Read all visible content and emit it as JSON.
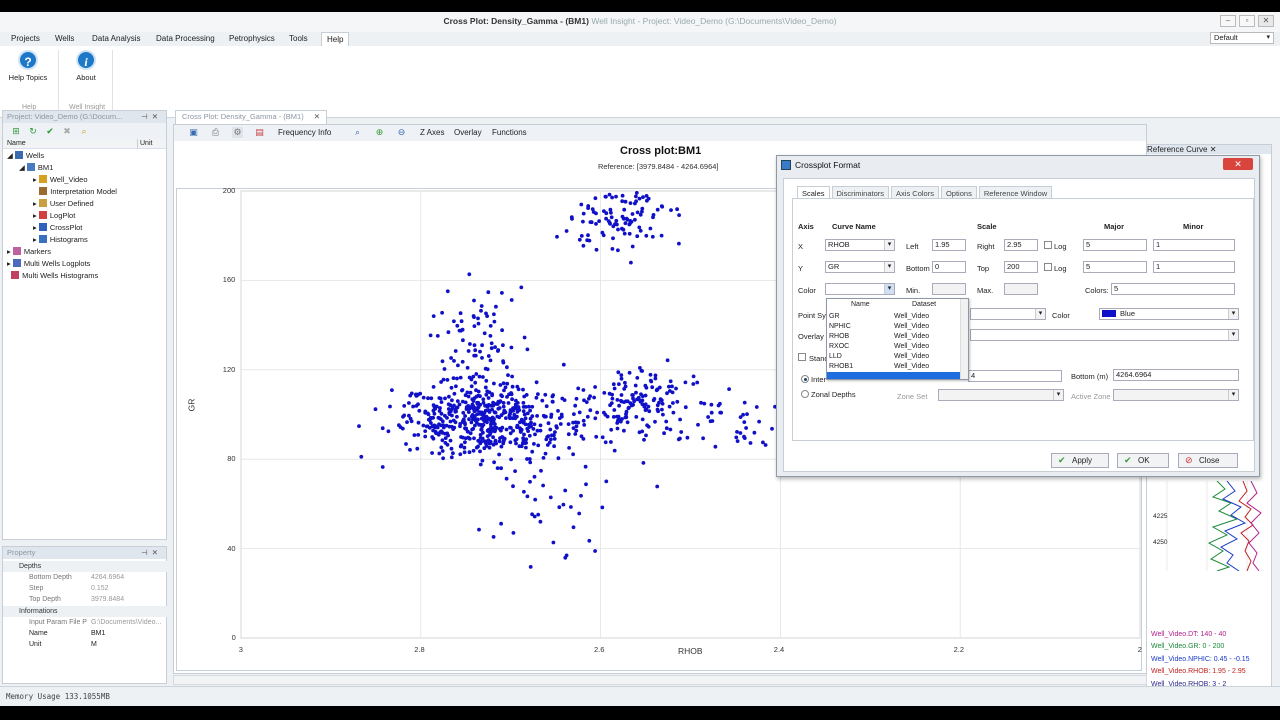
{
  "window": {
    "title_main": "Cross Plot: Density_Gamma - (BM1)",
    "title_sub": "Well Insight - Project: Video_Demo (G:\\Documents\\Video_Demo)",
    "controls": [
      "–",
      "▫",
      "✕"
    ]
  },
  "menu": [
    "Projects",
    "Wells",
    "Data Analysis",
    "Data Processing",
    "Petrophysics",
    "Tools",
    "Help"
  ],
  "active_menu": "Help",
  "layout_select": "Default",
  "ribbon": {
    "help_topics": "Help Topics",
    "about": "About",
    "group_help": "Help",
    "group_wellinsight": "Well Insight"
  },
  "project_panel": {
    "title": "Project: Video_Demo (G:\\Docum...",
    "col_name": "Name",
    "col_unit": "Unit",
    "tree": [
      {
        "label": "Wells",
        "level": 0
      },
      {
        "label": "BM1",
        "level": 1
      },
      {
        "label": "Well_Video",
        "level": 2
      },
      {
        "label": "Interpretation Model",
        "level": 2
      },
      {
        "label": "User Defined",
        "level": 2
      },
      {
        "label": "LogPlot",
        "level": 2
      },
      {
        "label": "CrossPlot",
        "level": 2
      },
      {
        "label": "Histograms",
        "level": 2
      },
      {
        "label": "Markers",
        "level": 0
      },
      {
        "label": "Multi Wells Logplots",
        "level": 0
      },
      {
        "label": "Multi Wells Histograms",
        "level": 0
      }
    ]
  },
  "property_panel": {
    "title": "Property",
    "rows": [
      {
        "k": "Depths",
        "v": "",
        "cat": true
      },
      {
        "k": "Bottom Depth",
        "v": "4264.6964"
      },
      {
        "k": "Step",
        "v": "0.152"
      },
      {
        "k": "Top Depth",
        "v": "3979.8484"
      },
      {
        "k": "Informations",
        "v": "",
        "cat": true
      },
      {
        "k": "Input Param File P",
        "v": "G:\\Documents\\Video..."
      },
      {
        "k": "Name",
        "v": "BM1",
        "dark": true
      },
      {
        "k": "Unit",
        "v": "M",
        "dark": true
      }
    ]
  },
  "doc_tab": "Cross Plot: Density_Gamma - (BM1)",
  "plot_toolbar": {
    "frequency_info": "Frequency Info",
    "z_axes": "Z Axes",
    "overlay": "Overlay",
    "functions": "Functions"
  },
  "chart_data": {
    "type": "scatter",
    "title": "Cross plot:BM1",
    "subtitle": "Reference: [3979.8484 - 4264.6964]",
    "xlabel": "RHOB",
    "ylabel": "GR",
    "xlim": [
      3,
      2
    ],
    "ylim": [
      0,
      200
    ],
    "x_ticks": [
      "3",
      "2.8",
      "2.6",
      "2.4",
      "2.2",
      "2"
    ],
    "y_ticks": [
      "200",
      "160",
      "120",
      "80",
      "40",
      "0"
    ],
    "point_color": "#1010c8",
    "grid": true,
    "clusters": [
      {
        "cx": 2.73,
        "cy": 97,
        "sx": 0.05,
        "sy": 8,
        "n": 520
      },
      {
        "cx": 2.56,
        "cy": 104,
        "sx": 0.04,
        "sy": 9,
        "n": 160
      },
      {
        "cx": 2.44,
        "cy": 97,
        "sx": 0.03,
        "sy": 8,
        "n": 40
      },
      {
        "cx": 2.73,
        "cy": 130,
        "sx": 0.025,
        "sy": 14,
        "n": 90
      },
      {
        "cx": 2.58,
        "cy": 188,
        "sx": 0.03,
        "sy": 9,
        "n": 110
      },
      {
        "cx": 2.66,
        "cy": 58,
        "sx": 0.035,
        "sy": 10,
        "n": 35
      }
    ]
  },
  "reference_curve": {
    "title": "Reference Curve",
    "depth_labels": [
      "4225",
      "4250"
    ],
    "legend": [
      {
        "text": "Well_Video.DT: 140 - 40",
        "color": "#b0208c"
      },
      {
        "text": "Well_Video.GR: 0 - 200",
        "color": "#1a8a3a"
      },
      {
        "text": "Well_Video.NPHIC: 0.45 - -0.15",
        "color": "#1a3ac8"
      },
      {
        "text": "Well_Video.RHOB: 1.95 - 2.95",
        "color": "#c02020"
      },
      {
        "text": "Well_Video.RHOB: 3 - 2",
        "color": "#2a2a8a"
      }
    ]
  },
  "dialog": {
    "title": "Crossplot Format",
    "tabs": [
      "Scales",
      "Discriminators",
      "Axis Colors",
      "Options",
      "Reference Window"
    ],
    "hdr_axis": "Axis",
    "hdr_curve": "Curve Name",
    "hdr_scale": "Scale",
    "hdr_major": "Major",
    "hdr_minor": "Minor",
    "x_label": "X",
    "x_curve": "RHOB",
    "left_label": "Left",
    "left_val": "1.95",
    "right_label": "Right",
    "right_val": "2.95",
    "log_label": "Log",
    "x_major": "5",
    "x_minor": "1",
    "y_label": "Y",
    "y_curve": "GR",
    "bottom_label": "Bottom",
    "bottom_val": "0",
    "top_label": "Top",
    "top_val": "200",
    "y_major": "5",
    "y_minor": "1",
    "color_label": "Color",
    "min_label": "Min.",
    "max_label": "Max.",
    "colors_label": "Colors:",
    "colors_val": "5",
    "point_sym_label": "Point Sym",
    "color2_label": "Color",
    "color2_val": "Blue",
    "overlay_label": "Overlay",
    "stand_label": "Stand",
    "inter_label": "Inter",
    "depth_top_partial": "4",
    "bottom_m_label": "Bottom (m)",
    "bottom_m_val": "4264.6964",
    "zonal_label": "Zonal Depths",
    "zone_set_label": "Zone Set",
    "active_zone_label": "Active Zone",
    "apply": "Apply",
    "ok": "OK",
    "close": "Close",
    "dropdown": {
      "col_name": "Name",
      "col_dataset": "Dataset",
      "rows": [
        {
          "name": "GR",
          "dataset": "Well_Video"
        },
        {
          "name": "NPHIC",
          "dataset": "Well_Video"
        },
        {
          "name": "RHOB",
          "dataset": "Well_Video"
        },
        {
          "name": "RXOC",
          "dataset": "Well_Video"
        },
        {
          "name": "LLD",
          "dataset": "Well_Video"
        },
        {
          "name": "RHOB1",
          "dataset": "Well_Video"
        }
      ]
    }
  },
  "status": {
    "memory": "Memory Usage 133.1055MB"
  }
}
